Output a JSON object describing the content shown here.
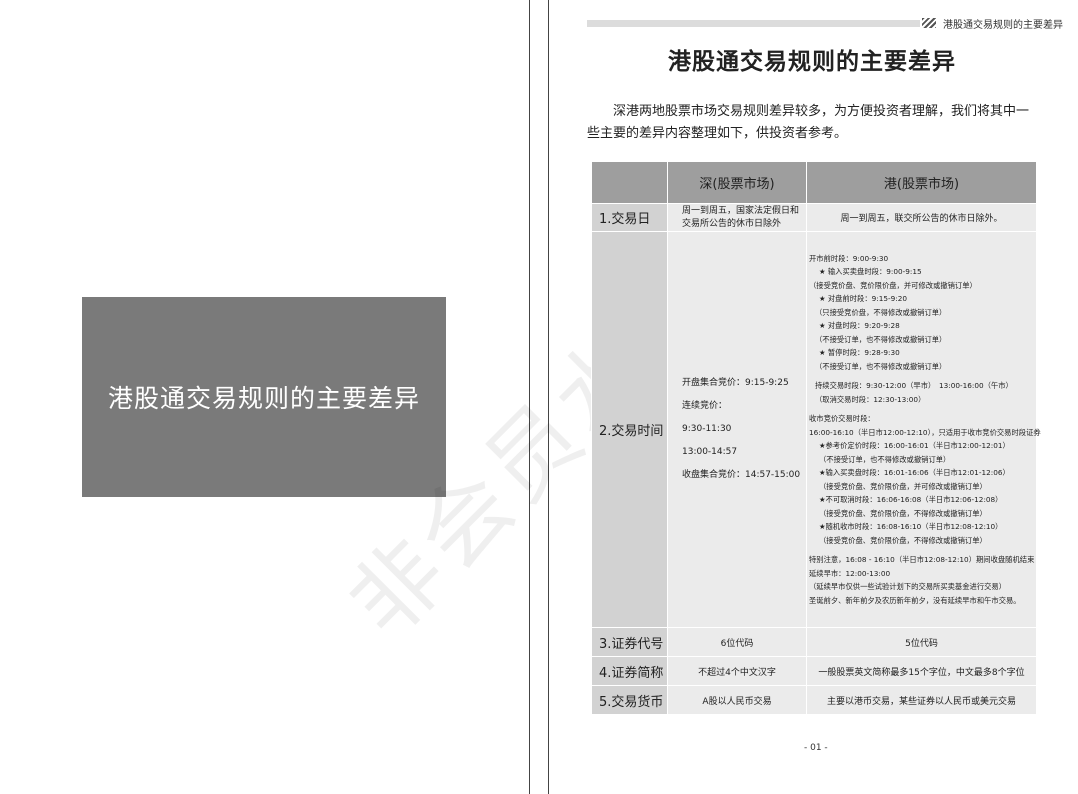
{
  "cover": {
    "title": "港股通交易规则的主要差异",
    "watermark": "非会员水印"
  },
  "header": {
    "running_title": "港股通交易规则的主要差异"
  },
  "page": {
    "title": "港股通交易规则的主要差异",
    "intro": "深港两地股票市场交易规则差异较多，为方便投资者理解，我们将其中一些主要的差异内容整理如下，供投资者参考。",
    "page_number": "- 01 -"
  },
  "table": {
    "headers": {
      "shenzhen": "深(股票市场)",
      "hongkong": "港(股票市场)"
    },
    "rows": {
      "trading_day": {
        "label": "1.交易日",
        "sz": [
          "周一到周五，国家法定假日和",
          "交易所公告的休市日除外"
        ],
        "hk": "周一到周五，联交所公告的休市日除外。"
      },
      "trading_time": {
        "label": "2.交易时间",
        "sz": {
          "open_auction": "开盘集合竞价：9:15-9:25",
          "continuous_label": "连续竞价：",
          "continuous_1": "9:30-11:30",
          "continuous_2": "13:00-14:57",
          "close_auction": "收盘集合竞价：14:57-15:00"
        },
        "hk": [
          "开市前时段：9:00-9:30",
          "★ 输入买卖盘时段：9:00-9:15",
          "（接受竞价盘、竞价限价盘，并可修改或撤销订单）",
          "★ 对盘前时段：9:15-9:20",
          "（只接受竞价盘，不得修改或撤销订单）",
          "★ 对盘时段：9:20-9:28",
          "（不接受订单，也不得修改或撤销订单）",
          "★ 暂停时段：9:28-9:30",
          "（不接受订单，也不得修改或撤销订单）",
          "持续交易时段：9:30-12:00（早市）　13:00-16:00（午市）",
          "（取消交易时段：12:30-13:00）",
          "收市竞价交易时段：",
          "16:00-16:10（半日市12:00-12:10），只适用于收市竞价交易时段证券",
          "★参考价定价时段：16:00-16:01（半日市12:00-12:01）",
          "（不接受订单，也不得修改或撤销订单）",
          "★输入买卖盘时段：16:01-16:06（半日市12:01-12:06）",
          "（接受竞价盘、竞价限价盘，并可修改或撤销订单）",
          "★不可取消时段：16:06-16:08（半日市12:06-12:08）",
          "（接受竞价盘、竞价限价盘，不得修改或撤销订单）",
          "★随机收市时段：16:08-16:10（半日市12:08-12:10）",
          "（接受竞价盘、竞价限价盘，不得修改或撤销订单）",
          "特别注意，16:08 - 16:10（半日市12:08-12:10）期间收盘随机结束",
          "延续早市：12:00-13:00",
          "（延续早市仅供一些试验计划下的交易所买卖基金进行交易）",
          "圣诞前夕、新年前夕及农历新年前夕，没有延续早市和午市交易。"
        ]
      },
      "security_code": {
        "label": "3.证券代号",
        "sz": "6位代码",
        "hk": "5位代码"
      },
      "security_abbr": {
        "label": "4.证券简称",
        "sz": "不超过4个中文汉字",
        "hk": "一般股票英文简称最多15个字位，中文最多8个字位"
      },
      "currency": {
        "label": "5.交易货币",
        "sz": "A股以人民币交易",
        "hk": "主要以港币交易，某些证券以人民币或美元交易"
      }
    }
  }
}
